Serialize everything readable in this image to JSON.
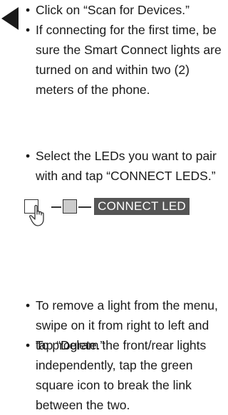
{
  "bullets": [
    "Click on “Scan for Devices.”",
    "If connecting for the first time, be sure the Smart Connect lights are turned on and within two (2) meters of the phone.",
    "Select the LEDs you want to pair with and tap “CONNECT LEDS.”",
    "To remove a light from the menu, swipe on it from right to left and tap “Delete.”",
    "To program the front/rear lights independently, tap the green square icon to break the link between the two."
  ],
  "diagram": {
    "button_label": "CONNECT LED",
    "button_color": "#555555",
    "selected_square_color": "#cccccc"
  },
  "icons": {
    "back_arrow": "left-triangle-arrow",
    "hand": "pointing-hand-icon"
  }
}
